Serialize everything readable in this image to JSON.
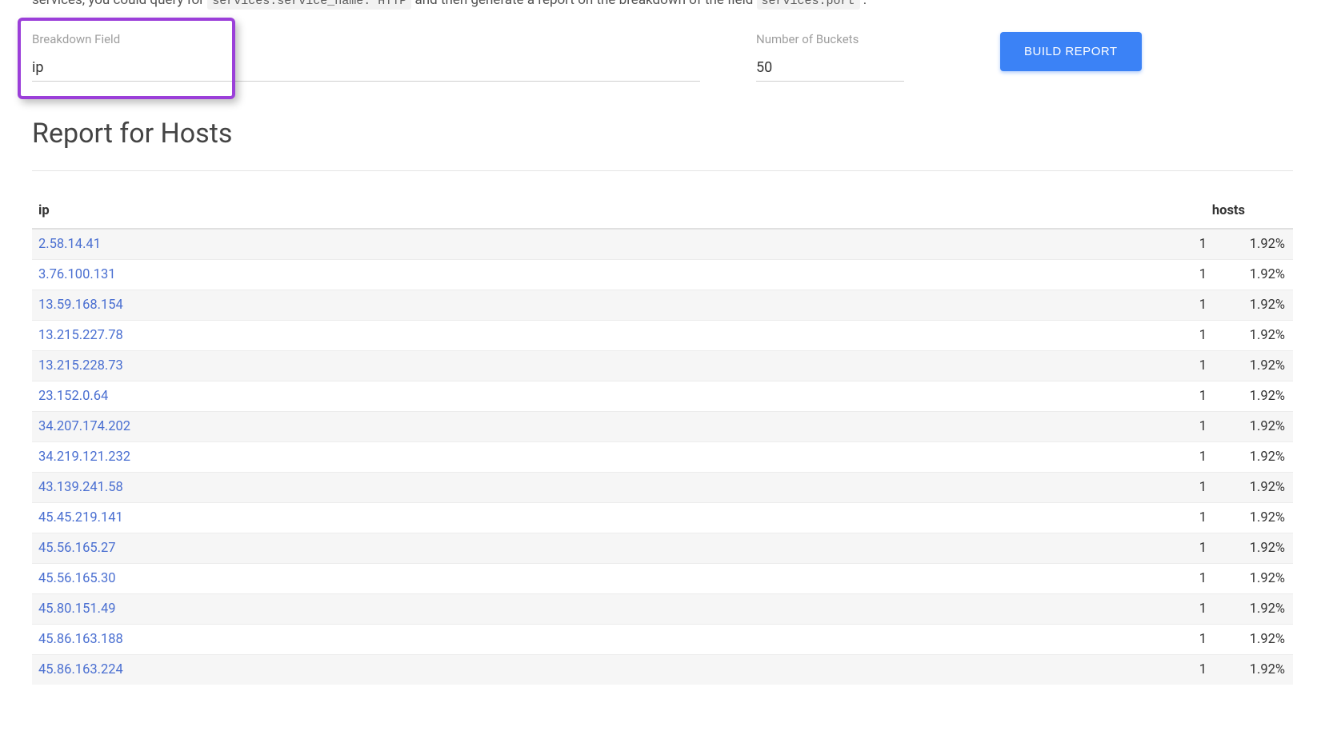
{
  "intro": {
    "prefix": "services, you could query for ",
    "code1": "services.service_name: HTTP",
    "mid": " and then generate a report on the breakdown of the field ",
    "code2": "services.port",
    "suffix": "."
  },
  "form": {
    "breakdown_label": "Breakdown Field",
    "breakdown_value": "ip",
    "buckets_label": "Number of Buckets",
    "buckets_value": "50",
    "build_label": "BUILD REPORT"
  },
  "report": {
    "title": "Report for Hosts",
    "col_ip": "ip",
    "col_hosts": "hosts",
    "rows": [
      {
        "ip": "2.58.14.41",
        "count": "1",
        "pct": "1.92%"
      },
      {
        "ip": "3.76.100.131",
        "count": "1",
        "pct": "1.92%"
      },
      {
        "ip": "13.59.168.154",
        "count": "1",
        "pct": "1.92%"
      },
      {
        "ip": "13.215.227.78",
        "count": "1",
        "pct": "1.92%"
      },
      {
        "ip": "13.215.228.73",
        "count": "1",
        "pct": "1.92%"
      },
      {
        "ip": "23.152.0.64",
        "count": "1",
        "pct": "1.92%"
      },
      {
        "ip": "34.207.174.202",
        "count": "1",
        "pct": "1.92%"
      },
      {
        "ip": "34.219.121.232",
        "count": "1",
        "pct": "1.92%"
      },
      {
        "ip": "43.139.241.58",
        "count": "1",
        "pct": "1.92%"
      },
      {
        "ip": "45.45.219.141",
        "count": "1",
        "pct": "1.92%"
      },
      {
        "ip": "45.56.165.27",
        "count": "1",
        "pct": "1.92%"
      },
      {
        "ip": "45.56.165.30",
        "count": "1",
        "pct": "1.92%"
      },
      {
        "ip": "45.80.151.49",
        "count": "1",
        "pct": "1.92%"
      },
      {
        "ip": "45.86.163.188",
        "count": "1",
        "pct": "1.92%"
      },
      {
        "ip": "45.86.163.224",
        "count": "1",
        "pct": "1.92%"
      }
    ]
  }
}
